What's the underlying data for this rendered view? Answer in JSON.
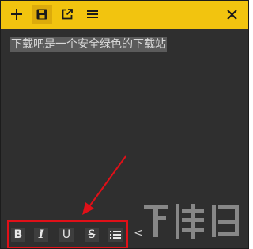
{
  "toolbar": {
    "buttons": [
      {
        "name": "add-note-button",
        "icon": "plus-icon"
      },
      {
        "name": "save-button",
        "icon": "save-icon"
      },
      {
        "name": "open-external-button",
        "icon": "external-link-icon"
      },
      {
        "name": "menu-button",
        "icon": "hamburger-icon"
      }
    ],
    "close_icon": "close-icon",
    "color": "#f2c40f"
  },
  "note": {
    "text": "下载吧是一个安全绿色的下载站",
    "style": "strikethrough"
  },
  "format_toolbar": {
    "buttons": [
      {
        "name": "bold-button",
        "label": "B"
      },
      {
        "name": "italic-button",
        "label": "I"
      },
      {
        "name": "underline-button",
        "label": "U"
      },
      {
        "name": "strikethrough-button",
        "label": "S"
      },
      {
        "name": "bullet-list-button",
        "icon": "list-icon"
      }
    ],
    "more_label": "<",
    "highlight_color": "#e01018"
  },
  "annotation": {
    "arrow_color": "#e01018"
  }
}
